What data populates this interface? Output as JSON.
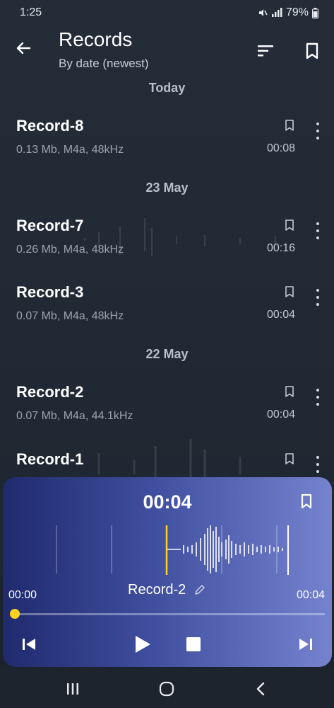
{
  "status_bar": {
    "time": "1:25",
    "battery": "79%"
  },
  "header": {
    "title": "Records",
    "subtitle": "By date (newest)"
  },
  "groups": [
    {
      "date": "Today",
      "records": [
        {
          "name": "Record-8",
          "info": "0.13 Mb, M4a, 48kHz",
          "duration": "00:08"
        }
      ]
    },
    {
      "date": "23 May",
      "records": [
        {
          "name": "Record-7",
          "info": "0.26 Mb, M4a, 48kHz",
          "duration": "00:16"
        },
        {
          "name": "Record-3",
          "info": "0.07 Mb, M4a, 48kHz",
          "duration": "00:04"
        }
      ]
    },
    {
      "date": "22 May",
      "records": [
        {
          "name": "Record-2",
          "info": "0.07 Mb, M4a, 44.1kHz",
          "duration": "00:04"
        },
        {
          "name": "Record-1",
          "info": "",
          "duration": ""
        }
      ]
    }
  ],
  "player": {
    "current_time": "00:04",
    "start_time": "00:00",
    "end_time": "00:04",
    "record_name": "Record-2",
    "progress": 0.0
  },
  "colors": {
    "accent": "#ffd21e",
    "background": "#232b37",
    "player_gradient_start": "#1f2a6e",
    "player_gradient_end": "#7583cf"
  },
  "icons": {
    "back": "arrow-left-icon",
    "sort": "sort-icon",
    "bookmark": "bookmark-icon",
    "menu": "more-vert-icon",
    "edit": "pencil-icon",
    "prev": "skip-previous-icon",
    "play": "play-icon",
    "stop": "stop-icon",
    "next": "skip-next-icon",
    "nav_recents": "recents-icon",
    "nav_home": "home-icon",
    "nav_back": "nav-back-icon"
  }
}
